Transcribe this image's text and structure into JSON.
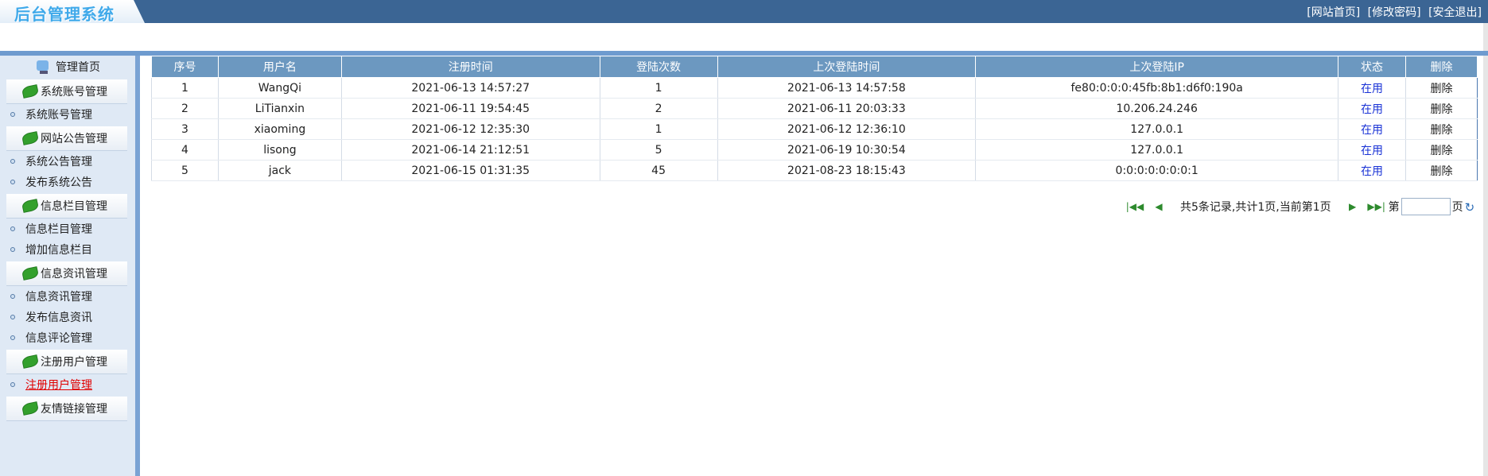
{
  "header": {
    "logo_text": "后台管理系统",
    "links": [
      "[网站首页]",
      "[修改密码]",
      "[安全退出]"
    ]
  },
  "sidebar": {
    "home": "管理首页",
    "groups": [
      {
        "title": "系统账号管理",
        "items": [
          "系统账号管理"
        ]
      },
      {
        "title": "网站公告管理",
        "items": [
          "系统公告管理",
          "发布系统公告"
        ]
      },
      {
        "title": "信息栏目管理",
        "items": [
          "信息栏目管理",
          "增加信息栏目"
        ]
      },
      {
        "title": "信息资讯管理",
        "items": [
          "信息资讯管理",
          "发布信息资讯",
          "信息评论管理"
        ]
      },
      {
        "title": "注册用户管理",
        "items": [
          "注册用户管理"
        ]
      },
      {
        "title": "友情链接管理",
        "items": []
      }
    ],
    "active_item": "注册用户管理"
  },
  "table": {
    "headers": [
      "序号",
      "用户名",
      "注册时间",
      "登陆次数",
      "上次登陆时间",
      "上次登陆IP",
      "状态",
      "删除"
    ],
    "rows": [
      [
        "1",
        "WangQi",
        "2021-06-13 14:57:27",
        "1",
        "2021-06-13 14:57:58",
        "fe80:0:0:0:45fb:8b1:d6f0:190a",
        "在用",
        "删除"
      ],
      [
        "2",
        "LiTianxin",
        "2021-06-11 19:54:45",
        "2",
        "2021-06-11 20:03:33",
        "10.206.24.246",
        "在用",
        "删除"
      ],
      [
        "3",
        "xiaoming",
        "2021-06-12 12:35:30",
        "1",
        "2021-06-12 12:36:10",
        "127.0.0.1",
        "在用",
        "删除"
      ],
      [
        "4",
        "lisong",
        "2021-06-14 21:12:51",
        "5",
        "2021-06-19 10:30:54",
        "127.0.0.1",
        "在用",
        "删除"
      ],
      [
        "5",
        "jack",
        "2021-06-15 01:31:35",
        "45",
        "2021-08-23 18:15:43",
        "0:0:0:0:0:0:0:1",
        "在用",
        "删除"
      ]
    ]
  },
  "pager": {
    "summary": "共5条记录,共计1页,当前第1页",
    "page_prefix": "第",
    "page_suffix": "页",
    "page_input_value": ""
  },
  "colors": {
    "topbar": "#3b6594",
    "table_header": "#6c98c0",
    "link": "#1a33d6",
    "active_menu": "#e00000"
  }
}
